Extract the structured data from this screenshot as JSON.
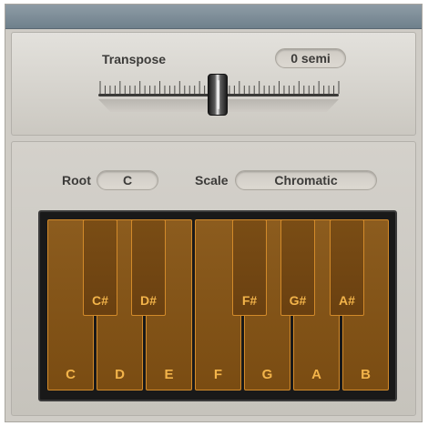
{
  "transpose": {
    "label": "Transpose",
    "value": "0 semi",
    "semitones": 0
  },
  "root": {
    "label": "Root",
    "value": "C"
  },
  "scale": {
    "label": "Scale",
    "value": "Chromatic"
  },
  "keyboard": {
    "white_keys": [
      "C",
      "D",
      "E",
      "F",
      "G",
      "A",
      "B"
    ],
    "black_keys": [
      "C#",
      "D#",
      "F#",
      "G#",
      "A#"
    ]
  },
  "colors": {
    "key_accent": "#f3b44a",
    "key_fill": "#7f5117"
  }
}
